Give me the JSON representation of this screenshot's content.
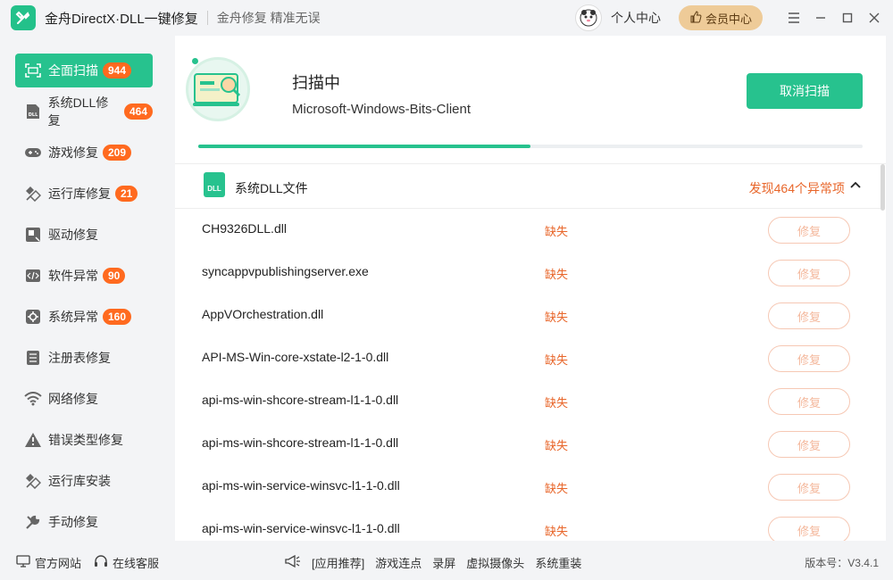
{
  "app": {
    "title": "金舟DirectX·DLL一键修复",
    "slogan": "金舟修复 精准无误",
    "user_center": "个人中心",
    "vip_center": "会员中心"
  },
  "sidebar": {
    "items": [
      {
        "label": "全面扫描",
        "badge": "944",
        "icon": "scan-icon"
      },
      {
        "label": "系统DLL修复",
        "badge": "464",
        "icon": "dll-icon"
      },
      {
        "label": "游戏修复",
        "badge": "209",
        "icon": "gamepad-icon"
      },
      {
        "label": "运行库修复",
        "badge": "21",
        "icon": "runtime-icon"
      },
      {
        "label": "驱动修复",
        "badge": "",
        "icon": "driver-icon"
      },
      {
        "label": "软件异常",
        "badge": "90",
        "icon": "code-icon"
      },
      {
        "label": "系统异常",
        "badge": "160",
        "icon": "gear-icon"
      },
      {
        "label": "注册表修复",
        "badge": "",
        "icon": "list-icon"
      },
      {
        "label": "网络修复",
        "badge": "",
        "icon": "wifi-icon"
      },
      {
        "label": "错误类型修复",
        "badge": "",
        "icon": "warning-icon"
      },
      {
        "label": "运行库安装",
        "badge": "",
        "icon": "install-icon"
      },
      {
        "label": "手动修复",
        "badge": "",
        "icon": "wrench-icon"
      }
    ]
  },
  "scan": {
    "status": "扫描中",
    "current_file": "Microsoft-Windows-Bits-Client",
    "cancel_label": "取消扫描",
    "progress": 0.5
  },
  "section": {
    "title": "系统DLL文件",
    "found_text": "发现464个异常项"
  },
  "files": [
    {
      "name": "CH9326DLL.dll",
      "status": "缺失",
      "action": "修复"
    },
    {
      "name": "syncappvpublishingserver.exe",
      "status": "缺失",
      "action": "修复"
    },
    {
      "name": "AppVOrchestration.dll",
      "status": "缺失",
      "action": "修复"
    },
    {
      "name": "API-MS-Win-core-xstate-l2-1-0.dll",
      "status": "缺失",
      "action": "修复"
    },
    {
      "name": "api-ms-win-shcore-stream-l1-1-0.dll",
      "status": "缺失",
      "action": "修复"
    },
    {
      "name": "api-ms-win-shcore-stream-l1-1-0.dll",
      "status": "缺失",
      "action": "修复"
    },
    {
      "name": "api-ms-win-service-winsvc-l1-1-0.dll",
      "status": "缺失",
      "action": "修复"
    },
    {
      "name": "api-ms-win-service-winsvc-l1-1-0.dll",
      "status": "缺失",
      "action": "修复"
    }
  ],
  "footer": {
    "official_site": "官方网站",
    "online_service": "在线客服",
    "recommend": "[应用推荐]",
    "links": [
      "游戏连点",
      "录屏",
      "虚拟摄像头",
      "系统重装"
    ],
    "version": "版本号：V3.4.1"
  },
  "colors": {
    "accent": "#27c28e",
    "badge": "#ff6a1f",
    "warning_text": "#e8662a",
    "vip": "#eecb98"
  }
}
